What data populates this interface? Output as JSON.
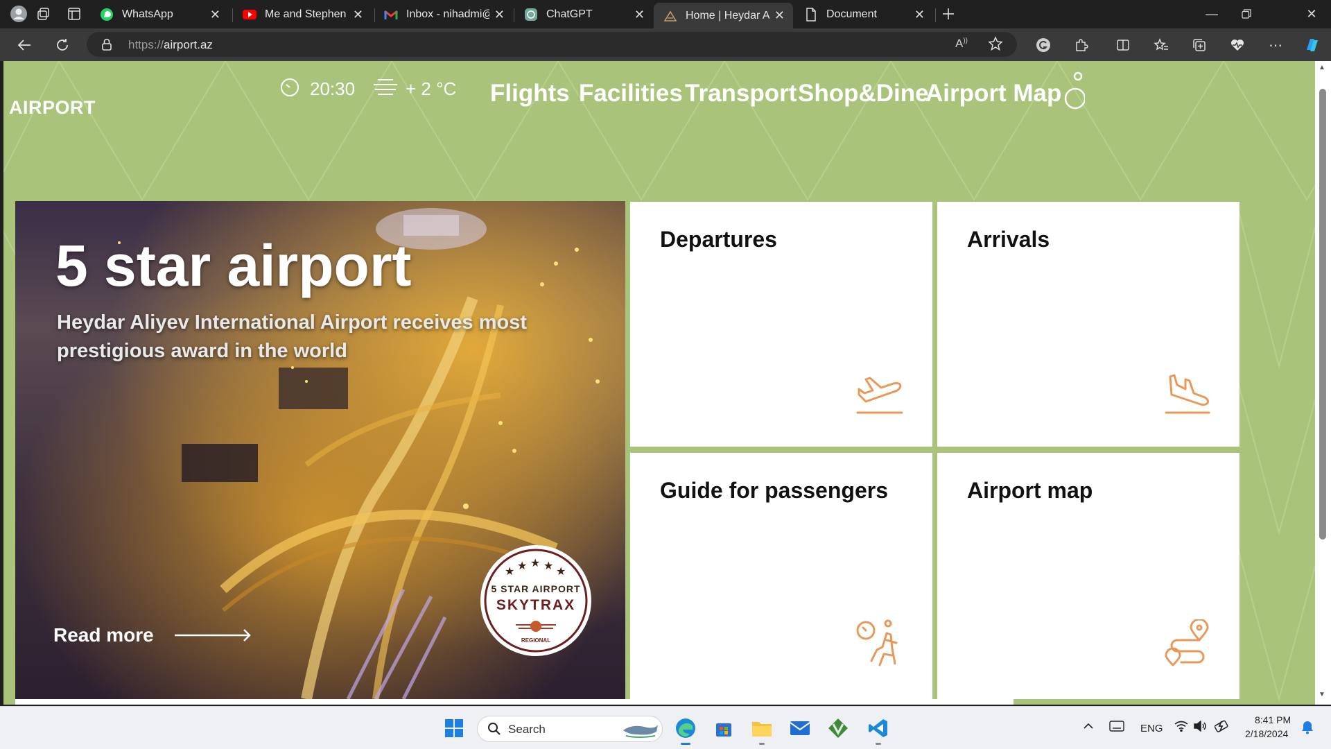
{
  "browser": {
    "tabs": [
      {
        "title": "WhatsApp",
        "favicon": "whatsapp-icon",
        "active": false
      },
      {
        "title": "Me and Stephen Hawking",
        "favicon": "youtube-icon",
        "active": false
      },
      {
        "title": "Inbox - nihadmi@code.edu.az",
        "favicon": "gmail-icon",
        "active": false
      },
      {
        "title": "ChatGPT",
        "favicon": "chatgpt-icon",
        "active": false
      },
      {
        "title": "Home | Heydar Aliyev International Airport",
        "favicon": "airport-icon",
        "active": true
      },
      {
        "title": "Document",
        "favicon": "document-icon",
        "active": false
      }
    ],
    "url_scheme": "https://",
    "url_host": "airport.az"
  },
  "header": {
    "logo": "AIRPORT",
    "time": "20:30",
    "temperature": "+ 2 °C",
    "menu": [
      "Flights",
      "Facilities",
      "Transport",
      "Shop&Dine",
      "Airport Map"
    ]
  },
  "hero": {
    "title": "5 star airport",
    "subtitle": "Heydar Aliyev International Airport receives most prestigious award in the world",
    "read_more": "Read more",
    "badge": {
      "line1": "5 STAR AIRPORT",
      "brand": "SKYTRAX",
      "line3": "REGIONAL"
    }
  },
  "cards": [
    {
      "title": "Departures",
      "icon": "departure-plane-icon"
    },
    {
      "title": "Arrivals",
      "icon": "arrival-plane-icon"
    },
    {
      "title": "Guide for passengers",
      "icon": "passenger-guide-icon"
    },
    {
      "title": "Airport map",
      "icon": "route-map-icon"
    }
  ],
  "taskbar": {
    "search_label": "Search",
    "language": "ENG",
    "time": "8:41 PM",
    "date": "2/18/2024"
  },
  "colors": {
    "page_green": "#a9c47a",
    "icon_orange": "#e8995a",
    "browser_dark": "#202020"
  }
}
